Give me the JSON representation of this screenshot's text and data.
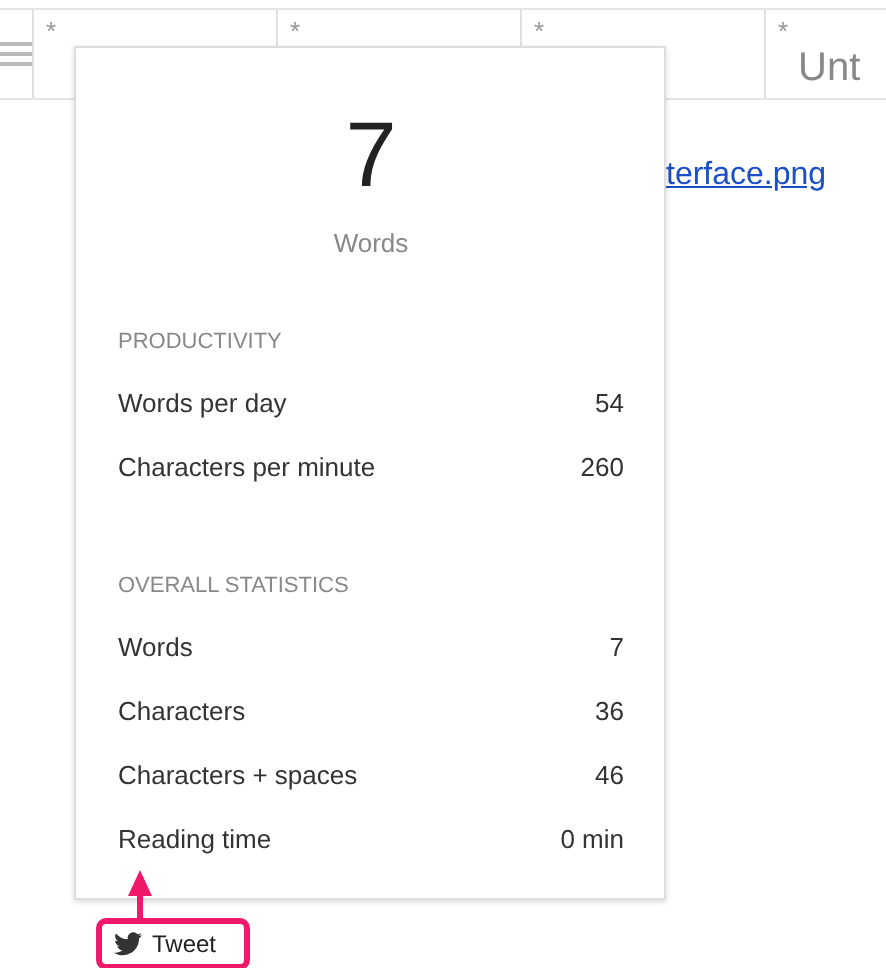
{
  "tabs": [
    {
      "marker": "*"
    },
    {
      "marker": "*"
    },
    {
      "marker": "*"
    },
    {
      "marker": "*",
      "label": "Unt"
    }
  ],
  "link": "terface.png",
  "stats": {
    "count": "7",
    "count_label": "Words",
    "sections": [
      {
        "title": "PRODUCTIVITY",
        "rows": [
          {
            "label": "Words per day",
            "value": "54"
          },
          {
            "label": "Characters per minute",
            "value": "260"
          }
        ]
      },
      {
        "title": "OVERALL STATISTICS",
        "rows": [
          {
            "label": "Words",
            "value": "7"
          },
          {
            "label": "Characters",
            "value": "36"
          },
          {
            "label": "Characters + spaces",
            "value": "46"
          },
          {
            "label": "Reading time",
            "value": "0 min"
          }
        ]
      }
    ]
  },
  "tweet_button": "Tweet"
}
